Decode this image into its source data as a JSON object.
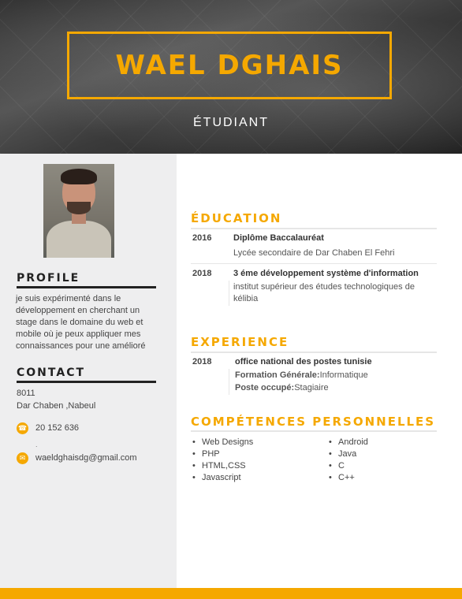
{
  "header": {
    "name": "WAEL DGHAIS",
    "role": "ÉTUDIANT"
  },
  "sidebar": {
    "profile_title": "PROFILE",
    "profile_text": "je suis expérimenté dans le développement en cherchant un stage dans le domaine du web et mobile où je peux appliquer mes connaissances pour une amélioré",
    "contact_title": "CONTACT",
    "address_line1": "8011",
    "address_line2": "Dar Chaben ,Nabeul",
    "phone": "20 152 636",
    "separator": ".",
    "email": "waeldghaisdg@gmail.com"
  },
  "education": {
    "title": "ÉDUCATION",
    "entries": [
      {
        "year": "2016",
        "title": "Diplôme Baccalauréat",
        "sub": "Lycée secondaire de Dar Chaben El Fehri"
      },
      {
        "year": "2018",
        "title": "3 éme développement système d'information",
        "sub": "institut supérieur des études technologiques de kélibia"
      }
    ]
  },
  "experience": {
    "title": "EXPERIENCE",
    "year": "2018",
    "company": "office national des postes tunisie",
    "formation_label": "Formation Générale:",
    "formation_value": "Informatique",
    "poste_label": "Poste occupé:",
    "poste_value": "Stagiaire"
  },
  "skills": {
    "title": "COMPÉTENCES PERSONNELLES",
    "col1": [
      "Web Designs",
      "PHP",
      "HTML,CSS",
      "Javascript"
    ],
    "col2": [
      "Android",
      "Java",
      "C",
      "C++"
    ]
  },
  "colors": {
    "accent": "#f5a800",
    "sidebar_bg": "#eeeeef",
    "dark_text": "#222222"
  },
  "icons": {
    "phone": "phone-icon",
    "email": "email-icon"
  }
}
